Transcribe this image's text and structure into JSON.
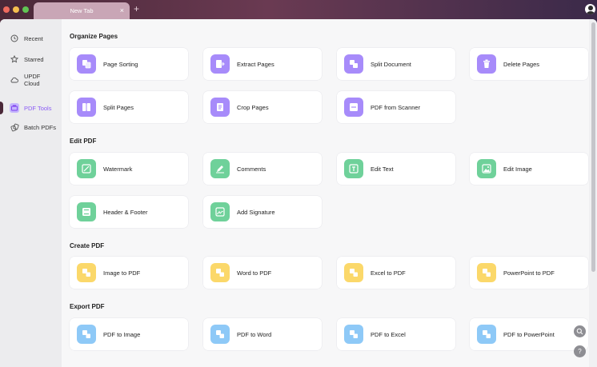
{
  "tab": {
    "title": "New Tab",
    "close": "×",
    "new": "+"
  },
  "sidebar": {
    "items": [
      {
        "label": "Recent",
        "icon": "clock-icon"
      },
      {
        "label": "Starred",
        "icon": "star-icon"
      },
      {
        "label": "UPDF Cloud",
        "icon": "cloud-icon"
      },
      {
        "label": "PDF Tools",
        "icon": "toolbox-icon",
        "active": true
      },
      {
        "label": "Batch PDFs",
        "icon": "batch-icon"
      }
    ]
  },
  "sections": {
    "organize": {
      "title": "Organize Pages",
      "items": [
        "Page Sorting",
        "Extract Pages",
        "Split Document",
        "Delete Pages",
        "Split Pages",
        "Crop Pages",
        "PDF from Scanner"
      ]
    },
    "edit": {
      "title": "Edit PDF",
      "items": [
        "Watermark",
        "Comments",
        "Edit Text",
        "Edit Image",
        "Header & Footer",
        "Add Signature"
      ]
    },
    "create": {
      "title": "Create PDF",
      "items": [
        "Image to PDF",
        "Word to PDF",
        "Excel to PDF",
        "PowerPoint to PDF"
      ]
    },
    "export": {
      "title": "Export PDF",
      "items": [
        "PDF to Image",
        "PDF to Word",
        "PDF to Excel",
        "PDF to PowerPoint"
      ]
    }
  },
  "help": {
    "glyph": "?"
  },
  "colors": {
    "organize": "#a78bfa",
    "edit": "#6fd19a",
    "create": "#fbd86a",
    "export": "#8ec9f7",
    "accent": "#8b5cf6"
  }
}
